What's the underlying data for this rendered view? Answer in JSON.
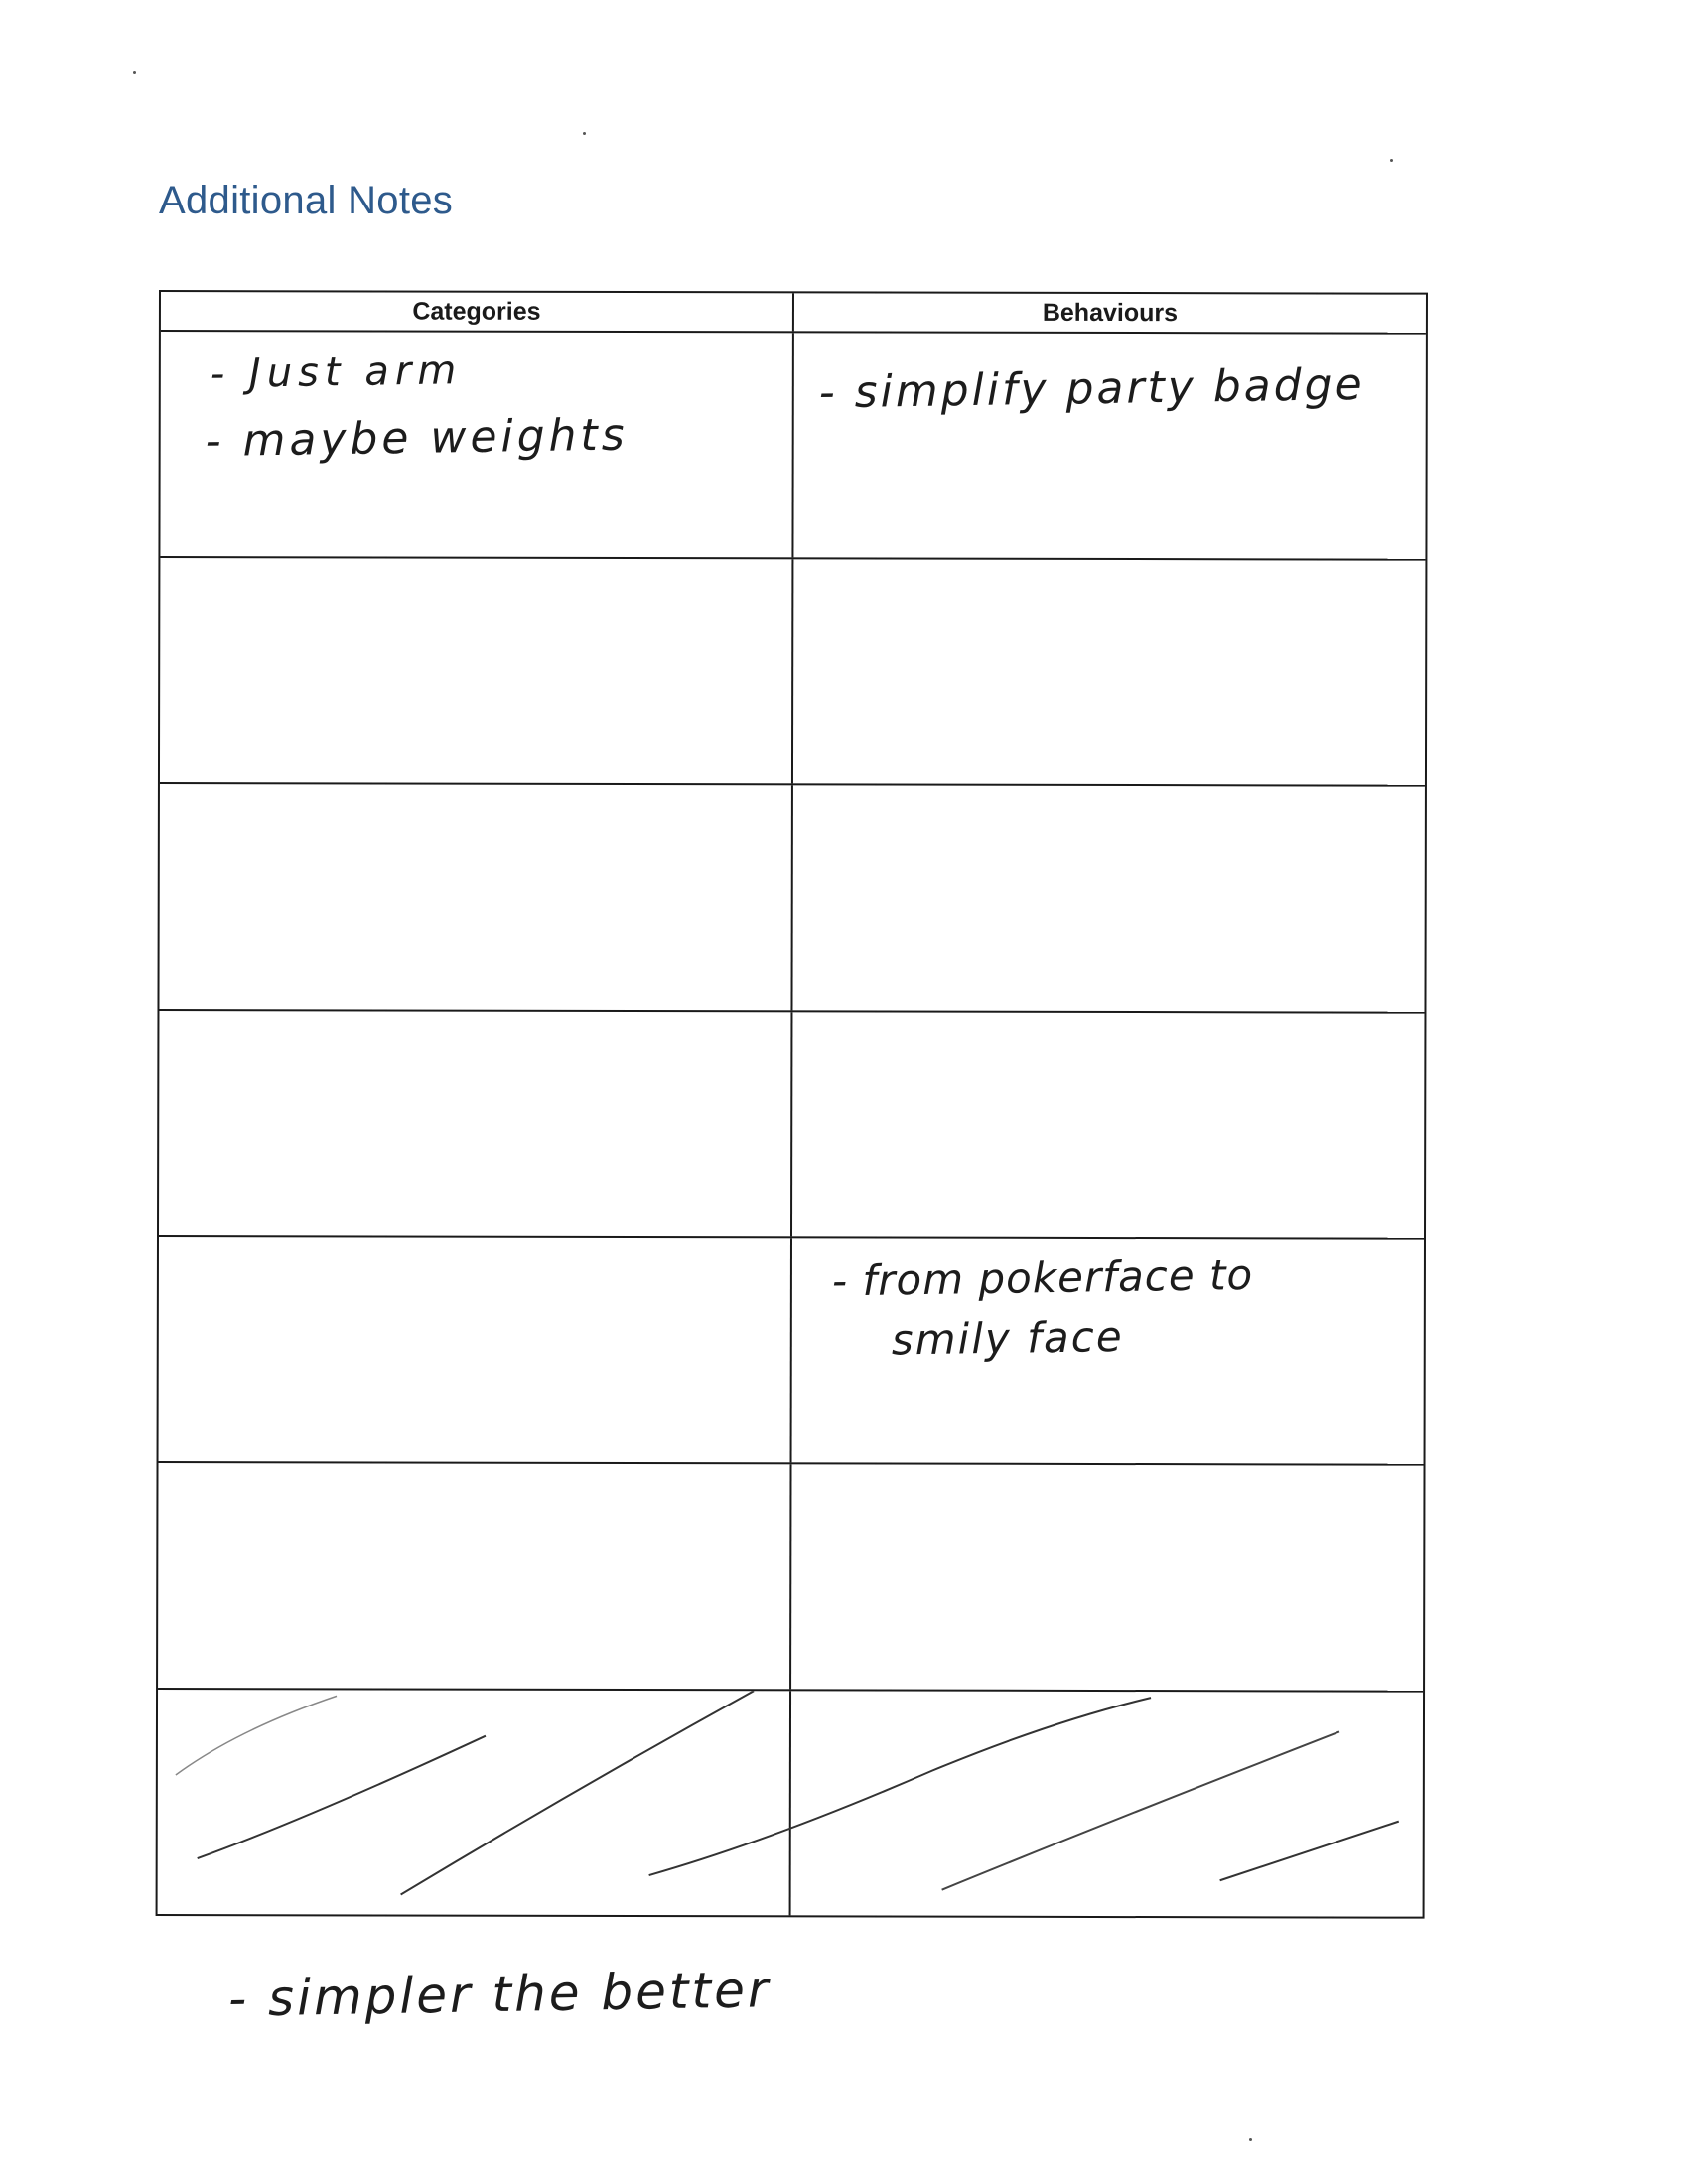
{
  "heading": "Additional Notes",
  "table": {
    "headers": [
      "Categories",
      "Behaviours"
    ],
    "rows": [
      {
        "categories": [
          "- Just arm",
          "- maybe weights"
        ],
        "behaviours": [
          "- simplify party badge"
        ]
      },
      {
        "categories": [],
        "behaviours": []
      },
      {
        "categories": [],
        "behaviours": []
      },
      {
        "categories": [],
        "behaviours": []
      },
      {
        "categories": [],
        "behaviours": [
          "- from pokerface to",
          "smily face"
        ]
      },
      {
        "categories": [],
        "behaviours": []
      },
      {
        "categories": [],
        "behaviours": [],
        "struck_through": true
      }
    ]
  },
  "footer_note": "- simpler the better"
}
